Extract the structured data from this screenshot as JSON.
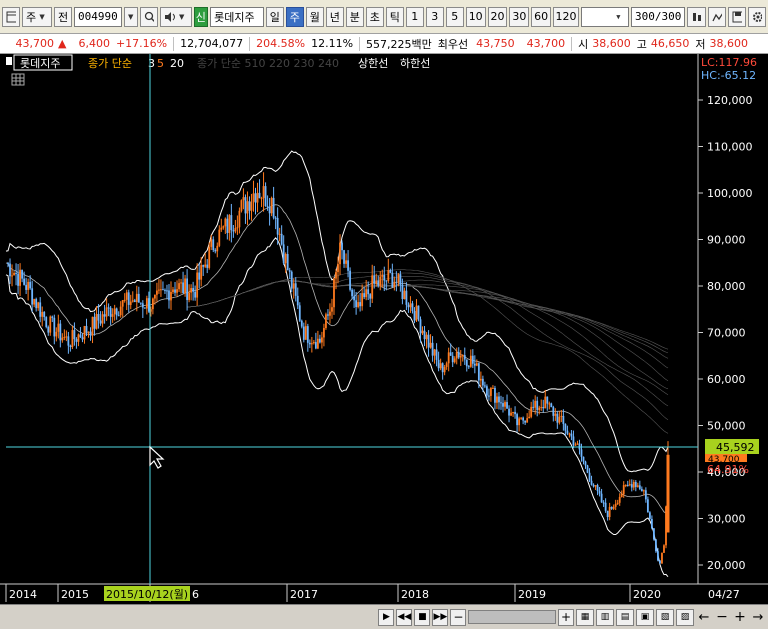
{
  "toolbar": {
    "market_btn": "주",
    "prev_btn": "전",
    "code": "004990",
    "kind_badge": "신",
    "stock_name": "롯데지주",
    "periods": [
      "일",
      "주",
      "월",
      "년"
    ],
    "selected_period": "주",
    "intraday": [
      "분",
      "초",
      "틱"
    ],
    "intervals": [
      "1",
      "3",
      "5",
      "10",
      "20",
      "30",
      "60",
      "120"
    ],
    "count": "300/300"
  },
  "quote": {
    "price": "43,700",
    "arrow": "▲",
    "change": "6,400",
    "change_pct": "+17.16%",
    "volume": "12,704,077",
    "volume_ratio": "204.58%",
    "turnover": "12.11%",
    "amount": "557,225백만",
    "best_ask_label": "최우선",
    "best_ask": "43,750",
    "best_bid": "43,700",
    "open_label": "시",
    "open": "38,600",
    "high_label": "고",
    "high": "46,650",
    "low_label": "저",
    "low": "38,600"
  },
  "legend": {
    "name": "롯데지주",
    "ma1": "종가 단순",
    "ma1_periods": [
      "3",
      "5",
      "20"
    ],
    "ma2": "종가 단순 510 220 230 240",
    "upper": "상한선",
    "lower": "하한선"
  },
  "lc": "LC:117.96",
  "hc": "HC:-65.12",
  "crosshair_date": "2015/10/12(월)",
  "crosshair_price": "45,592",
  "last_price_tag": "43,700",
  "last_pct_tag": "64.91%",
  "last_date": "04/27",
  "colors": {
    "up": "#ff7a1e",
    "down": "#6fb6ff",
    "crosshair": "#4fd6e0",
    "price_tag": "#a8d21e"
  },
  "chart_data": {
    "type": "candlestick",
    "x_ticks": [
      "2014",
      "2015",
      "2016",
      "2017",
      "2018",
      "2019",
      "2020"
    ],
    "y_ticks": [
      20000,
      30000,
      40000,
      50000,
      60000,
      70000,
      80000,
      90000,
      100000,
      110000,
      120000
    ],
    "y_tick_labels": [
      "20,000",
      "30,000",
      "40,000",
      "50,000",
      "60,000",
      "70,000",
      "80,000",
      "90,000",
      "100,000",
      "110,000",
      "120,000"
    ],
    "ylim": [
      17000,
      127000
    ],
    "weekly_close_approx": [
      [
        2014.0,
        85000
      ],
      [
        2014.2,
        80000
      ],
      [
        2014.4,
        72000
      ],
      [
        2014.6,
        68000
      ],
      [
        2014.8,
        71000
      ],
      [
        2015.0,
        75000
      ],
      [
        2015.2,
        77000
      ],
      [
        2015.4,
        76000
      ],
      [
        2015.6,
        80000
      ],
      [
        2015.8,
        79000
      ],
      [
        2016.0,
        90000
      ],
      [
        2016.2,
        95000
      ],
      [
        2016.4,
        101000
      ],
      [
        2016.55,
        98000
      ],
      [
        2016.7,
        83000
      ],
      [
        2016.85,
        70000
      ],
      [
        2017.0,
        68000
      ],
      [
        2017.1,
        75000
      ],
      [
        2017.2,
        88000
      ],
      [
        2017.35,
        74000
      ],
      [
        2017.5,
        80000
      ],
      [
        2017.7,
        82000
      ],
      [
        2017.9,
        75000
      ],
      [
        2018.0,
        70000
      ],
      [
        2018.15,
        62000
      ],
      [
        2018.3,
        66000
      ],
      [
        2018.45,
        64000
      ],
      [
        2018.6,
        58000
      ],
      [
        2018.75,
        55000
      ],
      [
        2018.9,
        50000
      ],
      [
        2019.0,
        53000
      ],
      [
        2019.15,
        55000
      ],
      [
        2019.3,
        51000
      ],
      [
        2019.45,
        46000
      ],
      [
        2019.6,
        38000
      ],
      [
        2019.75,
        31000
      ],
      [
        2019.9,
        36000
      ],
      [
        2020.0,
        38000
      ],
      [
        2020.1,
        36000
      ],
      [
        2020.2,
        25000
      ],
      [
        2020.25,
        20000
      ],
      [
        2020.3,
        26000
      ],
      [
        2020.33,
        43700
      ]
    ]
  }
}
